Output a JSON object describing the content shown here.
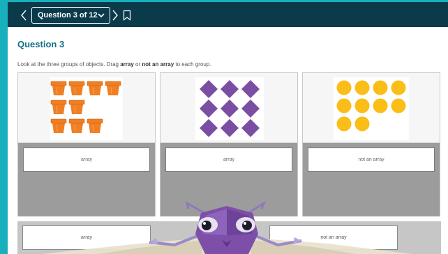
{
  "topbar": {
    "question_selector": "Question 3 of 12"
  },
  "question": {
    "title": "Question 3",
    "instructions": {
      "before": "Look at the three groups of objects. Drag ",
      "bold1": "array",
      "middle": " or ",
      "bold2": "not an array",
      "after": " to each group."
    }
  },
  "groups": [
    {
      "image": "flower-pots-group",
      "answer": "array"
    },
    {
      "image": "purple-diamonds-group",
      "answer": "array"
    },
    {
      "image": "yellow-circles-group",
      "answer": "not an array"
    }
  ],
  "answer_bank": [
    "array",
    "not an array"
  ],
  "icons": [
    "chevron-left-icon",
    "chevron-down-icon",
    "chevron-right-icon",
    "bookmark-icon"
  ],
  "colors": {
    "topbar": "#0b3b4b",
    "frame": "#18b0bd",
    "title": "#0f6f86",
    "pot": "#f07f24",
    "diamond": "#7a4fa3",
    "circle": "#fbbd18",
    "drop_area": "#9c9c9c"
  }
}
